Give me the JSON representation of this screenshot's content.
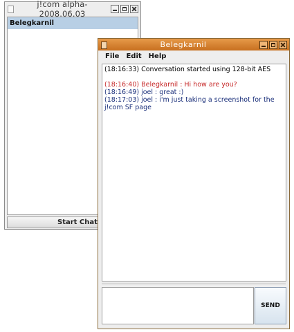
{
  "contact_window": {
    "title": "j!com alpha-2008.06.03",
    "contacts": [
      {
        "name": "Belegkarnil"
      }
    ],
    "start_chat_label": "Start Chat"
  },
  "chat_window": {
    "title": "Belegkarnil",
    "menu": [
      {
        "label": "File"
      },
      {
        "label": "Edit"
      },
      {
        "label": "Help"
      }
    ],
    "messages": [
      {
        "type": "system",
        "text": "(18:16:33) Conversation started using 128-bit AES"
      },
      {
        "type": "remote",
        "text": "(18:16:40) Belegkarnil : Hi how are you?"
      },
      {
        "type": "local",
        "text": "(18:16:49) joel : great :)"
      },
      {
        "type": "local",
        "text": "(18:17:03) joel : i'm just taking a screenshot for the j!com SF page"
      }
    ],
    "message_input": {
      "value": "",
      "placeholder": ""
    },
    "send_label": "SEND",
    "colors": {
      "titlebar": "#d5823a",
      "remote_message": "#c62828",
      "local_message": "#1a2f7a",
      "selection": "#b8cfe5"
    }
  }
}
